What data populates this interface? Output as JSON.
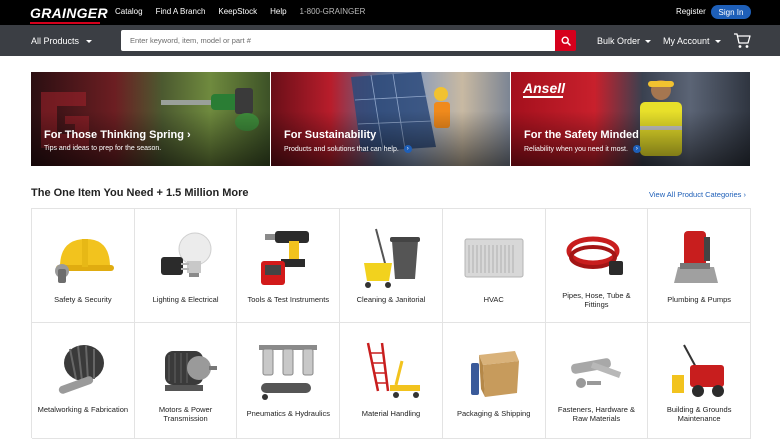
{
  "header": {
    "logo_text": "GRAINGER",
    "links": [
      "Catalog",
      "Find A Branch",
      "KeepStock",
      "Help"
    ],
    "phone": "1-800-GRAINGER",
    "register": "Register",
    "sign_in": "Sign In"
  },
  "nav": {
    "all_products": "All Products",
    "search_placeholder": "Enter keyword, item, model or part #",
    "bulk_order": "Bulk Order",
    "my_account": "My Account"
  },
  "promos": [
    {
      "title": "For Those Thinking Spring",
      "subtitle": "Tips and ideas to prep for the season."
    },
    {
      "title": "For Sustainability",
      "subtitle": "Products and solutions that can help."
    },
    {
      "title": "For the Safety Minded",
      "subtitle": "Reliability when you need it most.",
      "brand": "Ansell"
    }
  ],
  "categories_section": {
    "title": "The One Item You Need + 1.5 Million More",
    "view_all": "View All Product Categories"
  },
  "categories": [
    {
      "label": "Safety & Security",
      "icon": "hard-hat-icon"
    },
    {
      "label": "Lighting & Electrical",
      "icon": "light-bulb-icon"
    },
    {
      "label": "Tools & Test Instruments",
      "icon": "drill-icon"
    },
    {
      "label": "Cleaning & Janitorial",
      "icon": "mop-bucket-icon"
    },
    {
      "label": "HVAC",
      "icon": "air-conditioner-icon"
    },
    {
      "label": "Pipes, Hose, Tube & Fittings",
      "icon": "hose-icon"
    },
    {
      "label": "Plumbing & Pumps",
      "icon": "pump-icon"
    },
    {
      "label": "Metalworking & Fabrication",
      "icon": "cutter-icon"
    },
    {
      "label": "Motors & Power Transmission",
      "icon": "motor-icon"
    },
    {
      "label": "Pneumatics & Hydraulics",
      "icon": "pneumatic-icon"
    },
    {
      "label": "Material Handling",
      "icon": "pallet-jack-icon"
    },
    {
      "label": "Packaging & Shipping",
      "icon": "box-icon"
    },
    {
      "label": "Fasteners, Hardware & Raw Materials",
      "icon": "hardware-icon"
    },
    {
      "label": "Building & Grounds Maintenance",
      "icon": "snow-blower-icon"
    }
  ],
  "colors": {
    "brand_red": "#d6001c",
    "accent_blue": "#1e5fb8",
    "nav_gray": "#3b3e44"
  }
}
